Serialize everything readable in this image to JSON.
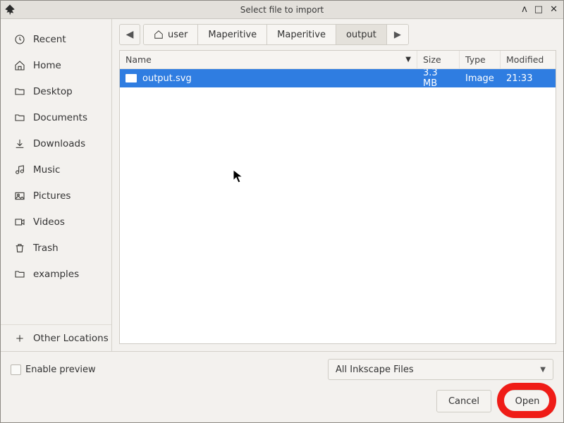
{
  "window": {
    "title": "Select file to import"
  },
  "sidebar": {
    "items": [
      {
        "icon": "clock",
        "label": "Recent"
      },
      {
        "icon": "home",
        "label": "Home"
      },
      {
        "icon": "folder",
        "label": "Desktop"
      },
      {
        "icon": "folder",
        "label": "Documents"
      },
      {
        "icon": "download",
        "label": "Downloads"
      },
      {
        "icon": "music",
        "label": "Music"
      },
      {
        "icon": "image",
        "label": "Pictures"
      },
      {
        "icon": "video",
        "label": "Videos"
      },
      {
        "icon": "trash",
        "label": "Trash"
      },
      {
        "icon": "folder",
        "label": "examples"
      }
    ],
    "other": {
      "icon": "plus",
      "label": "Other Locations"
    }
  },
  "path": {
    "segments": [
      {
        "label": "user",
        "home": true
      },
      {
        "label": "Maperitive"
      },
      {
        "label": "Maperitive"
      },
      {
        "label": "output",
        "current": true
      }
    ]
  },
  "columns": {
    "name": "Name",
    "size": "Size",
    "type": "Type",
    "modified": "Modified"
  },
  "files": [
    {
      "name": "output.svg",
      "size": "3.3 MB",
      "type": "Image",
      "modified": "21:33",
      "selected": true
    }
  ],
  "preview_toggle_label": "Enable preview",
  "filter": {
    "label": "All Inkscape Files"
  },
  "buttons": {
    "cancel": "Cancel",
    "open": "Open"
  }
}
